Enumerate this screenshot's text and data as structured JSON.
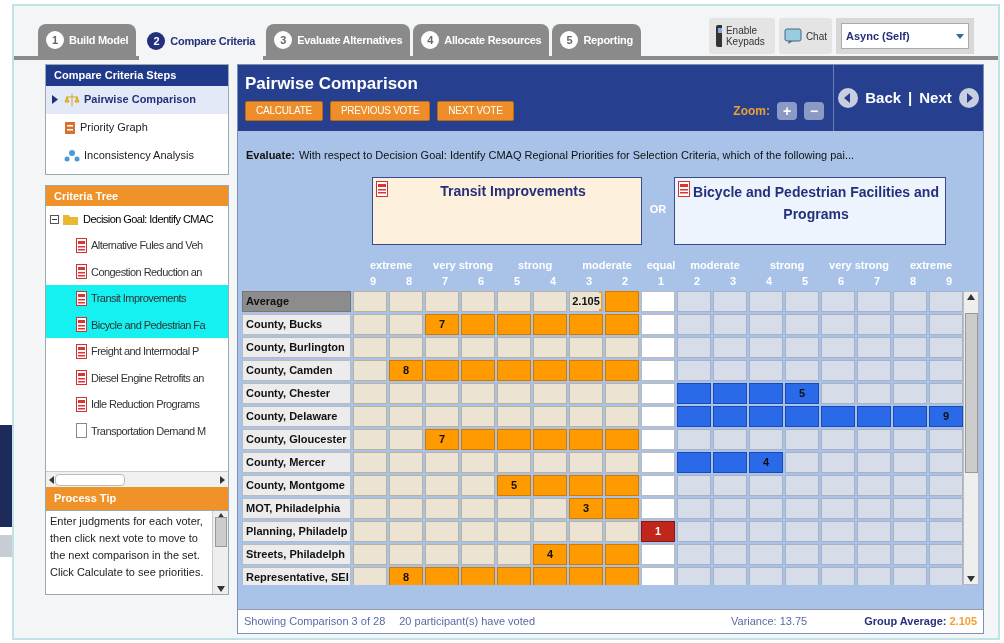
{
  "tabs": [
    {
      "number": "1",
      "label": "Build Model",
      "selected": false
    },
    {
      "number": "2",
      "label": "Compare Criteria",
      "selected": true
    },
    {
      "number": "3",
      "label": "Evaluate Alternatives",
      "selected": false
    },
    {
      "number": "4",
      "label": "Allocate Resources",
      "selected": false
    },
    {
      "number": "5",
      "label": "Reporting",
      "selected": false
    }
  ],
  "toolbar": {
    "keypads_button": "Enable Keypads",
    "chat_button": "Chat",
    "mode_select": "Async (Self)"
  },
  "steps": {
    "title": "Compare Criteria Steps",
    "items": [
      {
        "label": "Pairwise Comparison",
        "selected": true
      },
      {
        "label": "Priority Graph",
        "selected": false
      },
      {
        "label": "Inconsistency Analysis",
        "selected": false
      }
    ]
  },
  "criteria_tree": {
    "title": "Criteria Tree",
    "root": {
      "label": "Decision Goal: Identify CMAC",
      "expanded": true,
      "children": [
        {
          "label": "Alternative Fules and Veh",
          "selected": false,
          "kind": "red"
        },
        {
          "label": "Congestion Reduction an",
          "selected": false,
          "kind": "red"
        },
        {
          "label": "Transit Improvements",
          "selected": true,
          "kind": "red"
        },
        {
          "label": "Bicycle and Pedestrian Fa",
          "selected": true,
          "kind": "red"
        },
        {
          "label": "Freight and Intermodal P",
          "selected": false,
          "kind": "red"
        },
        {
          "label": "Diesel Engine Retrofits an",
          "selected": false,
          "kind": "red"
        },
        {
          "label": "Idle Reduction Programs",
          "selected": false,
          "kind": "red"
        },
        {
          "label": "Transportation Demand M",
          "selected": false,
          "kind": "blank"
        }
      ]
    }
  },
  "process_tip": {
    "title": "Process Tip",
    "text": "Enter judgments for each voter, then click next vote to move to the next comparison in the set. Click Calculate to see priorities."
  },
  "panel": {
    "title": "Pairwise Comparison",
    "buttons": [
      "CALCULATE",
      "PREVIOUS VOTE",
      "NEXT VOTE"
    ],
    "zoom_label": "Zoom:",
    "zoom_in": "+",
    "zoom_out": "−",
    "back": "Back",
    "separator": "|",
    "next": "Next"
  },
  "evaluate": {
    "label": "Evaluate:",
    "text": "With respect to Decision Goal: Identify CMAQ Regional Priorities for Selection Criteria, which of the following pai..."
  },
  "left_item": "Transit Improvements",
  "or": "OR",
  "right_item": "Bicycle and Pedestrian Facilities and Programs",
  "scale_labels": [
    "extreme",
    "very strong",
    "strong",
    "moderate",
    "equal",
    "moderate",
    "strong",
    "very strong",
    "extreme"
  ],
  "scale_numbers": [
    "9",
    "8",
    "7",
    "6",
    "5",
    "4",
    "3",
    "2",
    "1",
    "2",
    "3",
    "4",
    "5",
    "6",
    "7",
    "8",
    "9"
  ],
  "rows": [
    {
      "label": "Average",
      "kind": "average",
      "value": "2.105"
    },
    {
      "label": "County, Bucks",
      "kind": "left",
      "value": "7"
    },
    {
      "label": "County, Burlington",
      "kind": "blank"
    },
    {
      "label": "County, Camden",
      "kind": "left",
      "value": "8"
    },
    {
      "label": "County, Chester",
      "kind": "right",
      "value": "5"
    },
    {
      "label": "County, Delaware",
      "kind": "right",
      "value": "9"
    },
    {
      "label": "County, Gloucester",
      "kind": "left",
      "value": "7"
    },
    {
      "label": "County, Mercer",
      "kind": "right",
      "value": "4"
    },
    {
      "label": "County, Montgome",
      "kind": "left",
      "value": "5"
    },
    {
      "label": "MOT, Philadelphia",
      "kind": "left",
      "value": "3"
    },
    {
      "label": "Planning, Philadelp",
      "kind": "equal",
      "value": "1"
    },
    {
      "label": "Streets, Philadelph",
      "kind": "left",
      "value": "4"
    },
    {
      "label": "Representative, SEI",
      "kind": "left",
      "value": "8"
    }
  ],
  "status": {
    "showing": "Showing Comparison 3 of 28",
    "voted": "20 participant(s) have voted",
    "variance": "Variance: 13.75",
    "group_average_label": "Group Average:",
    "group_average": "2.105"
  }
}
